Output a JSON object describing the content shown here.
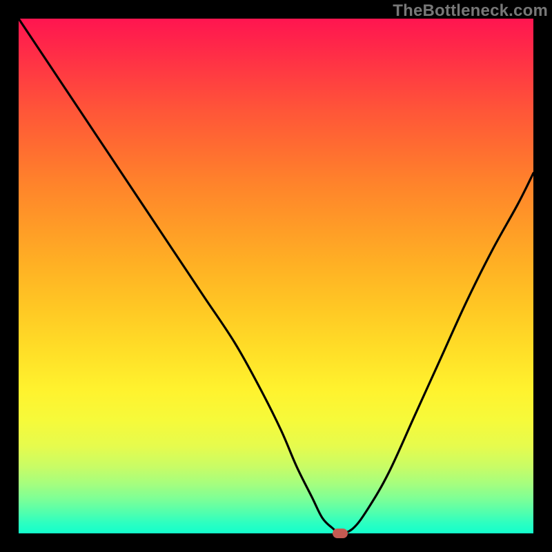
{
  "watermark": "TheBottleneck.com",
  "colors": {
    "frame": "#000000",
    "curve_stroke": "#000000",
    "marker_fill": "#c45a52"
  },
  "chart_data": {
    "type": "line",
    "title": "",
    "xlabel": "",
    "ylabel": "",
    "xlim": [
      0,
      100
    ],
    "ylim": [
      0,
      100
    ],
    "grid": false,
    "legend": false,
    "series": [
      {
        "name": "bottleneck-curve",
        "x": [
          0,
          6,
          12,
          18,
          24,
          30,
          36,
          42,
          47,
          51,
          54,
          57,
          59,
          61,
          62.5,
          65,
          68,
          72,
          77,
          82,
          87,
          92,
          97,
          100
        ],
        "values": [
          100,
          91,
          82,
          73,
          64,
          55,
          46,
          37,
          28,
          20,
          13,
          7,
          3,
          1,
          0,
          1,
          5,
          12,
          23,
          34,
          45,
          55,
          64,
          70
        ]
      }
    ],
    "marker": {
      "x": 62.5,
      "y": 0,
      "label": "optimal-point"
    },
    "background_gradient": [
      {
        "stop": 0,
        "color": "#ff1550"
      },
      {
        "stop": 50,
        "color": "#ffc724"
      },
      {
        "stop": 80,
        "color": "#f6fa3a"
      },
      {
        "stop": 100,
        "color": "#13ffcc"
      }
    ]
  }
}
